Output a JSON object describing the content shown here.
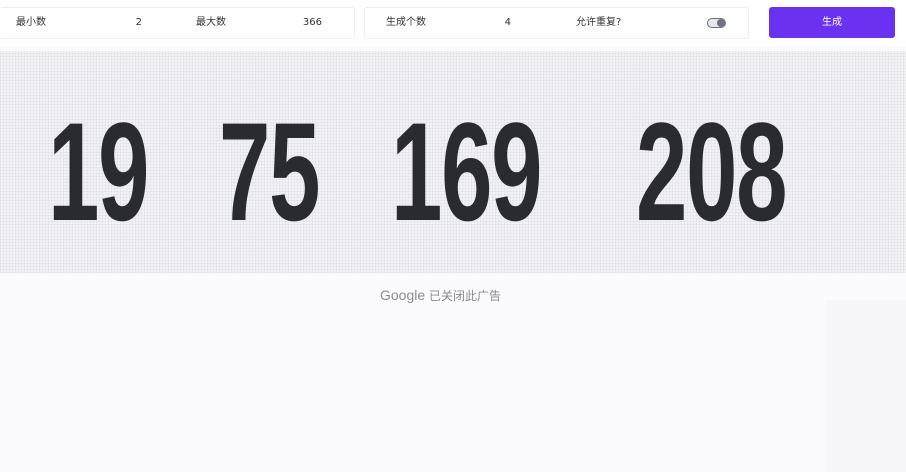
{
  "toolbar": {
    "min_label": "最小数",
    "min_value": "2",
    "max_label": "最大数",
    "max_value": "366",
    "count_label": "生成个数",
    "count_value": "4",
    "repeat_label": "允许重复?",
    "repeat_enabled": true,
    "generate_label": "生成",
    "accent_color": "#6a32f0"
  },
  "results": {
    "numbers": [
      "19",
      "75",
      "169",
      "208"
    ]
  },
  "ad_notice": {
    "brand": "Google",
    "text": "已关闭此广告"
  }
}
